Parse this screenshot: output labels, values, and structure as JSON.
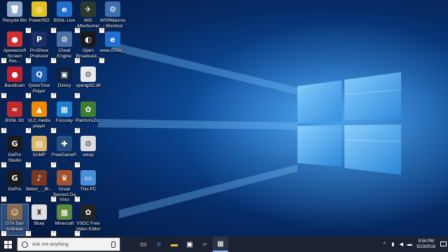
{
  "desktop": {
    "icons": [
      {
        "label": "Recycle Bin",
        "col": 0,
        "row": 0,
        "color": "#8aa6c8",
        "glyph": "🗑"
      },
      {
        "label": "PowerISO",
        "col": 1,
        "row": 0,
        "color": "#e3c21c",
        "glyph": "◎"
      },
      {
        "label": "BSNL Live",
        "col": 2,
        "row": 0,
        "color": "#1e6fd1",
        "glyph": "e"
      },
      {
        "label": "MSI Afterburner",
        "col": 3,
        "row": 0,
        "color": "#2c3a2c",
        "glyph": "✈"
      },
      {
        "label": "WSRMacros - Shortcut",
        "col": 4,
        "row": 0,
        "color": "#3d6fb0",
        "glyph": "⚙"
      },
      {
        "label": "Apowersoft Screen Rec...",
        "col": 0,
        "row": 1,
        "color": "#d12f2f",
        "glyph": "●"
      },
      {
        "label": "ProShow Producer",
        "col": 1,
        "row": 1,
        "color": "#1d2f66",
        "glyph": "P"
      },
      {
        "label": "Cheat Engine",
        "col": 2,
        "row": 1,
        "color": "#4a6fa5",
        "glyph": "⚙"
      },
      {
        "label": "Open Broadcast...",
        "col": 3,
        "row": 1,
        "color": "#1a1a1a",
        "glyph": "◐"
      },
      {
        "label": "www.GTAV...",
        "col": 4,
        "row": 1,
        "color": "#1e6fd1",
        "glyph": "e"
      },
      {
        "label": "Bandicam",
        "col": 0,
        "row": 2,
        "color": "#c61f2b",
        "glyph": "●"
      },
      {
        "label": "QuickTime Player",
        "col": 1,
        "row": 2,
        "color": "#1c5fb0",
        "glyph": "Q"
      },
      {
        "label": "Dxtory",
        "col": 2,
        "row": 2,
        "color": "#12233d",
        "glyph": "▣"
      },
      {
        "label": "opengl32.dll",
        "col": 3,
        "row": 2,
        "color": "#e8e8e8",
        "glyph": "⚙"
      },
      {
        "label": "BSNL 3G",
        "col": 0,
        "row": 3,
        "color": "#c02a2a",
        "glyph": "≈"
      },
      {
        "label": "VLC media player",
        "col": 1,
        "row": 3,
        "color": "#f08a00",
        "glyph": "▲"
      },
      {
        "label": "Focusky",
        "col": 2,
        "row": 3,
        "color": "#1b7fd0",
        "glyph": "▦"
      },
      {
        "label": "PlantsVsZo...",
        "col": 3,
        "row": 3,
        "color": "#3e7d2e",
        "glyph": "✿"
      },
      {
        "label": "GoPro Studio",
        "col": 0,
        "row": 4,
        "color": "#1a1a1a",
        "glyph": "G"
      },
      {
        "label": "SAMP",
        "col": 1,
        "row": 4,
        "color": "#d8b56a",
        "glyph": "▤"
      },
      {
        "label": "FreeGameP...",
        "col": 2,
        "row": 4,
        "color": "#25507f",
        "glyph": "✚"
      },
      {
        "label": "setup",
        "col": 3,
        "row": 4,
        "color": "#dcdcdc",
        "glyph": "⚙"
      },
      {
        "label": "GoPro",
        "col": 0,
        "row": 5,
        "color": "#1a1a1a",
        "glyph": "G"
      },
      {
        "label": "Bebot_-_Bl...",
        "col": 1,
        "row": 5,
        "color": "#7b3a1e",
        "glyph": "♪"
      },
      {
        "label": "Great Secrect Da Vinci",
        "col": 2,
        "row": 5,
        "color": "#a3542a",
        "glyph": "♛"
      },
      {
        "label": "This PC",
        "col": 3,
        "row": 5,
        "color": "#4a90d9",
        "glyph": "▭"
      },
      {
        "label": "GTA San Andreas",
        "col": 0,
        "row": 6,
        "color": "#8a6a4a",
        "glyph": "☺",
        "selected": true
      },
      {
        "label": "Bluej",
        "col": 1,
        "row": 6,
        "color": "#e0e0e0",
        "glyph": "♜"
      },
      {
        "label": "Minecraft",
        "col": 2,
        "row": 6,
        "color": "#5a8a3a",
        "glyph": "▩"
      },
      {
        "label": "VSDC Free Video Editor",
        "col": 3,
        "row": 6,
        "color": "#222222",
        "glyph": "✿"
      }
    ]
  },
  "taskbar": {
    "search_placeholder": "Ask me anything",
    "apps": [
      {
        "name": "task-view",
        "glyph": "▭",
        "active": false
      },
      {
        "name": "edge",
        "glyph": "e",
        "active": false
      },
      {
        "name": "file-explorer",
        "glyph": "▬",
        "active": false
      },
      {
        "name": "store",
        "glyph": "▣",
        "active": false
      },
      {
        "name": "app5",
        "glyph": "⌐",
        "active": false
      },
      {
        "name": "app6",
        "glyph": "▦",
        "active": true
      }
    ],
    "clock": {
      "time": "9:54 PM",
      "date": "5/23/2016"
    }
  },
  "colors": {
    "accent": "#1e6fd1",
    "taskbar": "#1b2233"
  }
}
